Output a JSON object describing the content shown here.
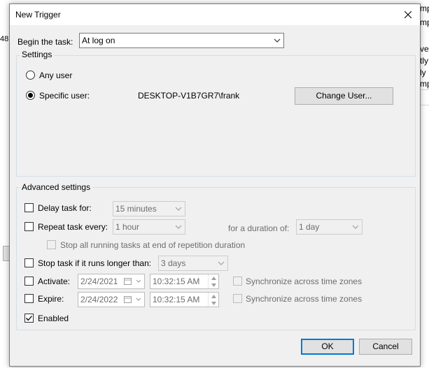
{
  "background": {
    "right_fragments": [
      "mp",
      "mp",
      "ve",
      "tly",
      "ly",
      "mp"
    ],
    "left_fragment": "48:"
  },
  "window": {
    "title": "New Trigger"
  },
  "begin_task": {
    "label": "Begin the task:",
    "value": "At log on"
  },
  "settings": {
    "title": "Settings",
    "any_user_label": "Any user",
    "specific_user_label": "Specific user:",
    "selected": "specific",
    "user_value": "DESKTOP-V1B7GR7\\frank",
    "change_user_button": "Change User..."
  },
  "advanced": {
    "title": "Advanced settings",
    "delay": {
      "label": "Delay task for:",
      "checked": false,
      "value": "15 minutes"
    },
    "repeat": {
      "label": "Repeat task every:",
      "checked": false,
      "value": "1 hour",
      "duration_label": "for a duration of:",
      "duration_value": "1 day",
      "stop_all_label": "Stop all running tasks at end of repetition duration"
    },
    "stop_if_longer": {
      "label": "Stop task if it runs longer than:",
      "checked": false,
      "value": "3 days"
    },
    "activate": {
      "label": "Activate:",
      "checked": false,
      "date": "2/24/2021",
      "time": "10:32:15 AM",
      "sync_label": "Synchronize across time zones"
    },
    "expire": {
      "label": "Expire:",
      "checked": false,
      "date": "2/24/2022",
      "time": "10:32:15 AM",
      "sync_label": "Synchronize across time zones"
    },
    "enabled": {
      "label": "Enabled",
      "checked": true
    }
  },
  "buttons": {
    "ok": "OK",
    "cancel": "Cancel"
  },
  "icons": [
    "close-icon",
    "dropdown-arrow-icon",
    "calendar-icon",
    "spin-arrows-icon",
    "checkmark-icon"
  ],
  "colors": {
    "accent": "#0078d7",
    "dialog_bg": "#f0f0f0",
    "disabled_text": "#6d6d6d"
  }
}
